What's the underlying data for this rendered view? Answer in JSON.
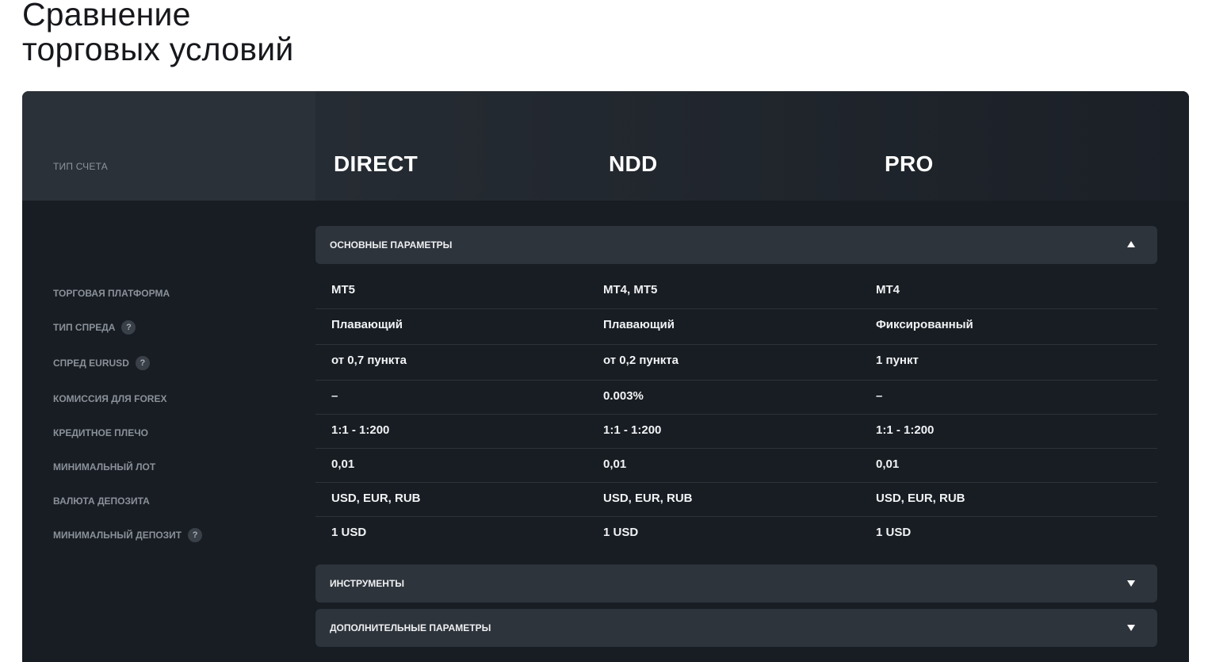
{
  "page": {
    "title_line1": "Сравнение",
    "title_line2": "торговых условий"
  },
  "table": {
    "header_label": "ТИП СЧЕТА",
    "accounts": [
      "DIRECT",
      "NDD",
      "PRO"
    ],
    "sections": {
      "main": {
        "label": "ОСНОВНЫЕ ПАРАМЕТРЫ",
        "expanded": true
      },
      "instruments": {
        "label": "ИНСТРУМЕНТЫ",
        "expanded": false
      },
      "extra": {
        "label": "ДОПОЛНИТЕЛЬНЫЕ ПАРАМЕТРЫ",
        "expanded": false
      }
    },
    "rows": [
      {
        "label": "ТОРГОВАЯ ПЛАТФОРМА",
        "help": false,
        "values": [
          "MT5",
          "MT4, MT5",
          "MT4"
        ]
      },
      {
        "label": "ТИП СПРЕДА",
        "help": true,
        "values": [
          "Плавающий",
          "Плавающий",
          "Фиксированный"
        ]
      },
      {
        "label": "СПРЕД EURUSD",
        "help": true,
        "values": [
          "от 0,7 пункта",
          "от 0,2 пункта",
          "1 пункт"
        ]
      },
      {
        "label": "КОМИССИЯ ДЛЯ FOREX",
        "help": false,
        "values": [
          "–",
          "0.003%",
          "–"
        ]
      },
      {
        "label": "КРЕДИТНОЕ ПЛЕЧО",
        "help": false,
        "values": [
          "1:1 - 1:200",
          "1:1 - 1:200",
          "1:1 - 1:200"
        ]
      },
      {
        "label": "МИНИМАЛЬНЫЙ ЛОТ",
        "help": false,
        "values": [
          "0,01",
          "0,01",
          "0,01"
        ]
      },
      {
        "label": "ВАЛЮТА ДЕПОЗИТА",
        "help": false,
        "values": [
          "USD, EUR, RUB",
          "USD, EUR, RUB",
          "USD, EUR, RUB"
        ]
      },
      {
        "label": "МИНИМАЛЬНЫЙ ДЕПОЗИТ",
        "help": true,
        "values": [
          "1 USD",
          "1 USD",
          "1 USD"
        ]
      }
    ],
    "help_glyph": "?",
    "icons": {
      "expanded": "caret-up-icon",
      "collapsed": "caret-down-icon"
    },
    "colors": {
      "panel": "#181d23",
      "section_bar": "#2e343c",
      "header": "#2b3138"
    }
  }
}
